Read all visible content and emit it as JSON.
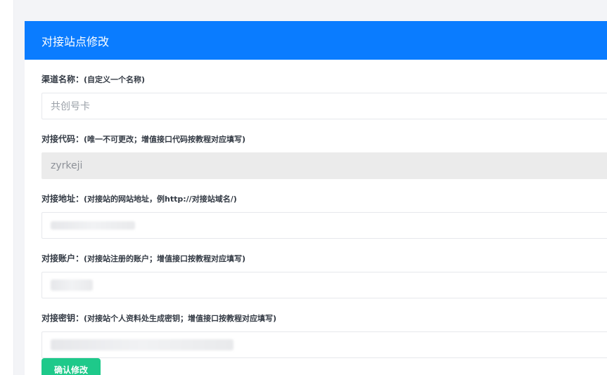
{
  "panel": {
    "title": "对接站点修改"
  },
  "form": {
    "channel_name": {
      "label": "渠道名称：",
      "hint": "(自定义一个名称)",
      "placeholder": "共创号卡"
    },
    "api_code": {
      "label": "对接代码：",
      "hint": "(唯一不可更改；增值接口代码按教程对应填写)",
      "value": "zyrkeji"
    },
    "site_url": {
      "label": "对接地址：",
      "hint": "(对接站的网站地址，例http://对接站域名/)"
    },
    "account": {
      "label": "对接账户：",
      "hint": "(对接站注册的账户；增值接口按教程对应填写)"
    },
    "secret_key": {
      "label": "对接密钥：",
      "hint": "(对接站个人资料处生成密钥；增值接口按教程对应填写)"
    },
    "submit_label": "确认修改"
  },
  "colors": {
    "header": "#0a7cff",
    "submit": "#1ec98a"
  }
}
